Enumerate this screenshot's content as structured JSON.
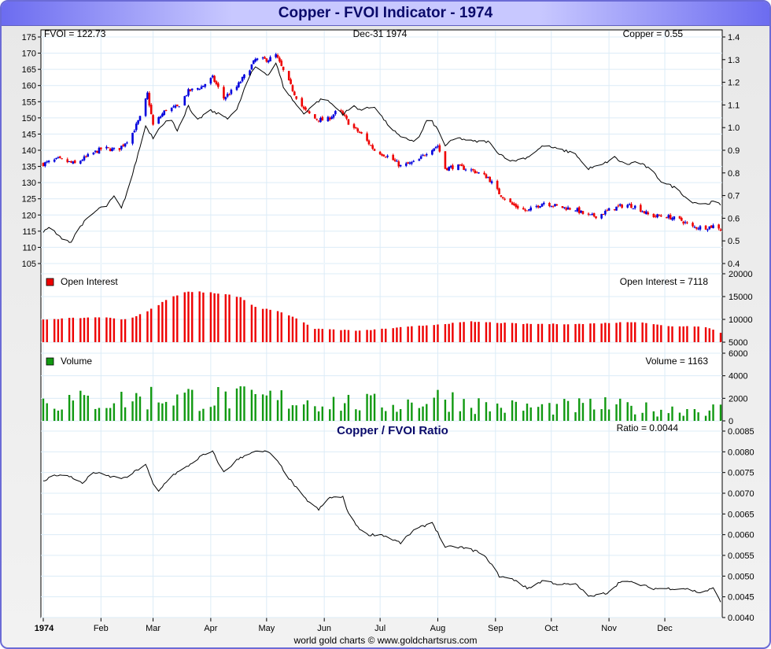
{
  "title": "Copper - FVOI Indicator - 1974",
  "footer": "world gold charts © www.goldchartsrus.com",
  "colors": {
    "up": "#0000dd",
    "down": "#ee0000",
    "oi": "#ee0000",
    "volume": "#119911",
    "line": "#000000",
    "grid": "#dcecf7",
    "title": "#0a0a6a"
  },
  "chart_data": [
    {
      "type": "line",
      "name": "price-panel",
      "labels": {
        "left": "FVOI = 122.73",
        "center": "Dec-31  1974",
        "right": "Copper = 0.55"
      },
      "left_axis": {
        "ticks": [
          105,
          110,
          115,
          120,
          125,
          130,
          135,
          140,
          145,
          150,
          155,
          160,
          165,
          170,
          175
        ],
        "range": [
          105,
          175
        ]
      },
      "right_axis": {
        "ticks": [
          0.4,
          0.5,
          0.6,
          0.7,
          0.8,
          0.9,
          1.0,
          1.1,
          1.2,
          1.3,
          1.4
        ],
        "tick_labels": [
          "0.4",
          "0.5",
          "0.6",
          "0.7",
          "0.8",
          "0.9",
          "1.0",
          "1.1",
          "1.2",
          "1.3",
          "1.4"
        ],
        "range": [
          0.4,
          1.4
        ]
      },
      "fvoi_line": [
        [
          0,
          114.7
        ],
        [
          4,
          116.4
        ],
        [
          8,
          113.5
        ],
        [
          15,
          111.6
        ],
        [
          19,
          116
        ],
        [
          25,
          119.6
        ],
        [
          30,
          122
        ],
        [
          34,
          122.8
        ],
        [
          38,
          125.7
        ],
        [
          42,
          122
        ],
        [
          47,
          130.5
        ],
        [
          51,
          139
        ],
        [
          55,
          147.5
        ],
        [
          59,
          143.9
        ],
        [
          63,
          147.5
        ],
        [
          68,
          150
        ],
        [
          72,
          146.3
        ],
        [
          78,
          153.6
        ],
        [
          82,
          148.7
        ],
        [
          89,
          152.4
        ],
        [
          95,
          151
        ],
        [
          99,
          150
        ],
        [
          104,
          152.4
        ],
        [
          110,
          162
        ],
        [
          114,
          165.8
        ],
        [
          121,
          163.3
        ],
        [
          125,
          167
        ],
        [
          129,
          159.7
        ],
        [
          135,
          154.8
        ],
        [
          140,
          151.2
        ],
        [
          144,
          153.6
        ],
        [
          150,
          156
        ],
        [
          154,
          154.8
        ],
        [
          161,
          151.2
        ],
        [
          167,
          153.6
        ],
        [
          171,
          152.4
        ],
        [
          178,
          153.6
        ],
        [
          184,
          148.7
        ],
        [
          192,
          143.9
        ],
        [
          201,
          142.7
        ],
        [
          207,
          150.4
        ],
        [
          212,
          146.3
        ],
        [
          216,
          141.5
        ],
        [
          222,
          143.9
        ],
        [
          231,
          142.7
        ],
        [
          239,
          142.7
        ],
        [
          245,
          139
        ],
        [
          252,
          136.6
        ],
        [
          260,
          137.8
        ],
        [
          269,
          141.5
        ],
        [
          277,
          140.3
        ],
        [
          286,
          139
        ],
        [
          292,
          134.2
        ],
        [
          300,
          135.4
        ],
        [
          307,
          137.8
        ],
        [
          313,
          135.4
        ],
        [
          319,
          136.6
        ],
        [
          326,
          134.2
        ],
        [
          332,
          130.5
        ],
        [
          341,
          128
        ],
        [
          347,
          124.4
        ],
        [
          355,
          123.2
        ],
        [
          362,
          124.4
        ],
        [
          364,
          122.73
        ]
      ],
      "copper_candles_close": [
        [
          0,
          0.84
        ],
        [
          8,
          0.86
        ],
        [
          17,
          0.84
        ],
        [
          23,
          0.87
        ],
        [
          32,
          0.91
        ],
        [
          40,
          0.9
        ],
        [
          47,
          0.96
        ],
        [
          53,
          1.06
        ],
        [
          56,
          1.15
        ],
        [
          59,
          1.01
        ],
        [
          66,
          1.08
        ],
        [
          72,
          1.09
        ],
        [
          78,
          1.16
        ],
        [
          85,
          1.18
        ],
        [
          91,
          1.22
        ],
        [
          97,
          1.13
        ],
        [
          104,
          1.18
        ],
        [
          110,
          1.25
        ],
        [
          114,
          1.3
        ],
        [
          121,
          1.3
        ],
        [
          125,
          1.32
        ],
        [
          129,
          1.25
        ],
        [
          135,
          1.15
        ],
        [
          140,
          1.08
        ],
        [
          146,
          1.04
        ],
        [
          152,
          1.03
        ],
        [
          159,
          1.08
        ],
        [
          165,
          1.01
        ],
        [
          171,
          0.97
        ],
        [
          178,
          0.9
        ],
        [
          186,
          0.87
        ],
        [
          192,
          0.83
        ],
        [
          201,
          0.85
        ],
        [
          207,
          0.9
        ],
        [
          212,
          0.92
        ],
        [
          216,
          0.82
        ],
        [
          222,
          0.83
        ],
        [
          231,
          0.81
        ],
        [
          239,
          0.78
        ],
        [
          245,
          0.71
        ],
        [
          252,
          0.66
        ],
        [
          260,
          0.63
        ],
        [
          269,
          0.67
        ],
        [
          277,
          0.65
        ],
        [
          286,
          0.64
        ],
        [
          292,
          0.61
        ],
        [
          298,
          0.61
        ],
        [
          305,
          0.64
        ],
        [
          313,
          0.66
        ],
        [
          319,
          0.65
        ],
        [
          326,
          0.61
        ],
        [
          334,
          0.61
        ],
        [
          343,
          0.59
        ],
        [
          349,
          0.56
        ],
        [
          357,
          0.56
        ],
        [
          362,
          0.57
        ],
        [
          364,
          0.55
        ]
      ]
    },
    {
      "type": "bar",
      "name": "open-interest",
      "legend": "Open Interest",
      "value_label": "Open Interest = 7118",
      "axis": {
        "ticks": [
          5000,
          10000,
          15000,
          20000
        ],
        "range": [
          5000,
          20000
        ]
      },
      "values": [
        [
          0,
          10000
        ],
        [
          30,
          10500
        ],
        [
          45,
          10000
        ],
        [
          55,
          11500
        ],
        [
          65,
          14000
        ],
        [
          75,
          16000
        ],
        [
          90,
          16000
        ],
        [
          105,
          15000
        ],
        [
          115,
          12500
        ],
        [
          125,
          12000
        ],
        [
          135,
          10500
        ],
        [
          145,
          8000
        ],
        [
          170,
          7500
        ],
        [
          200,
          8500
        ],
        [
          230,
          9500
        ],
        [
          260,
          9000
        ],
        [
          290,
          9000
        ],
        [
          320,
          9500
        ],
        [
          335,
          8500
        ],
        [
          355,
          8500
        ],
        [
          364,
          7118
        ]
      ]
    },
    {
      "type": "bar",
      "name": "volume",
      "legend": "Volume",
      "value_label": "Volume = 1163",
      "axis": {
        "ticks": [
          0,
          2000,
          4000,
          6000
        ],
        "range": [
          0,
          6000
        ]
      },
      "values": [
        [
          0,
          1900
        ],
        [
          40,
          2000
        ],
        [
          60,
          2400
        ],
        [
          80,
          2300
        ],
        [
          100,
          2200
        ],
        [
          130,
          2100
        ],
        [
          160,
          1800
        ],
        [
          190,
          1600
        ],
        [
          215,
          2300
        ],
        [
          240,
          1400
        ],
        [
          270,
          1300
        ],
        [
          300,
          1500
        ],
        [
          330,
          1100
        ],
        [
          364,
          1163
        ]
      ]
    },
    {
      "type": "line",
      "name": "ratio",
      "title": "Copper / FVOI Ratio",
      "value_label": "Ratio = 0.0044",
      "axis": {
        "ticks": [
          0.004,
          0.0045,
          0.005,
          0.0055,
          0.006,
          0.0065,
          0.007,
          0.0075,
          0.008,
          0.0085
        ],
        "tick_labels": [
          "0.0040",
          "0.0045",
          "0.0050",
          "0.0055",
          "0.0060",
          "0.0065",
          "0.0070",
          "0.0075",
          "0.0080",
          "0.0085"
        ],
        "range": [
          0.004,
          0.0085
        ]
      },
      "values": [
        [
          0,
          0.00728
        ],
        [
          6,
          0.00745
        ],
        [
          15,
          0.0074
        ],
        [
          21,
          0.00723
        ],
        [
          27,
          0.00751
        ],
        [
          36,
          0.0074
        ],
        [
          44,
          0.00736
        ],
        [
          55,
          0.0077
        ],
        [
          61,
          0.00698
        ],
        [
          68,
          0.0074
        ],
        [
          76,
          0.0076
        ],
        [
          85,
          0.0079
        ],
        [
          91,
          0.008
        ],
        [
          97,
          0.0075
        ],
        [
          104,
          0.0078
        ],
        [
          112,
          0.008
        ],
        [
          121,
          0.008
        ],
        [
          127,
          0.0077
        ],
        [
          133,
          0.0073
        ],
        [
          140,
          0.0069
        ],
        [
          148,
          0.0066
        ],
        [
          154,
          0.0069
        ],
        [
          161,
          0.0069
        ],
        [
          165,
          0.0064
        ],
        [
          173,
          0.006
        ],
        [
          182,
          0.006
        ],
        [
          192,
          0.0058
        ],
        [
          199,
          0.0061
        ],
        [
          209,
          0.0063
        ],
        [
          216,
          0.0057
        ],
        [
          224,
          0.0057
        ],
        [
          233,
          0.0056
        ],
        [
          239,
          0.0054
        ],
        [
          245,
          0.005
        ],
        [
          254,
          0.0049
        ],
        [
          260,
          0.0047
        ],
        [
          269,
          0.0049
        ],
        [
          277,
          0.0048
        ],
        [
          286,
          0.0048
        ],
        [
          294,
          0.0045
        ],
        [
          303,
          0.0046
        ],
        [
          311,
          0.0049
        ],
        [
          320,
          0.0048
        ],
        [
          328,
          0.0047
        ],
        [
          337,
          0.0047
        ],
        [
          345,
          0.0047
        ],
        [
          353,
          0.0046
        ],
        [
          360,
          0.0047
        ],
        [
          364,
          0.0044
        ]
      ]
    }
  ],
  "x_axis": {
    "labels": [
      "1974",
      "Feb",
      "Mar",
      "Apr",
      "May",
      "Jun",
      "Jul",
      "Aug",
      "Sep",
      "Oct",
      "Nov",
      "Dec"
    ],
    "days": [
      0,
      31,
      59,
      90,
      120,
      151,
      181,
      212,
      243,
      273,
      304,
      334
    ]
  }
}
